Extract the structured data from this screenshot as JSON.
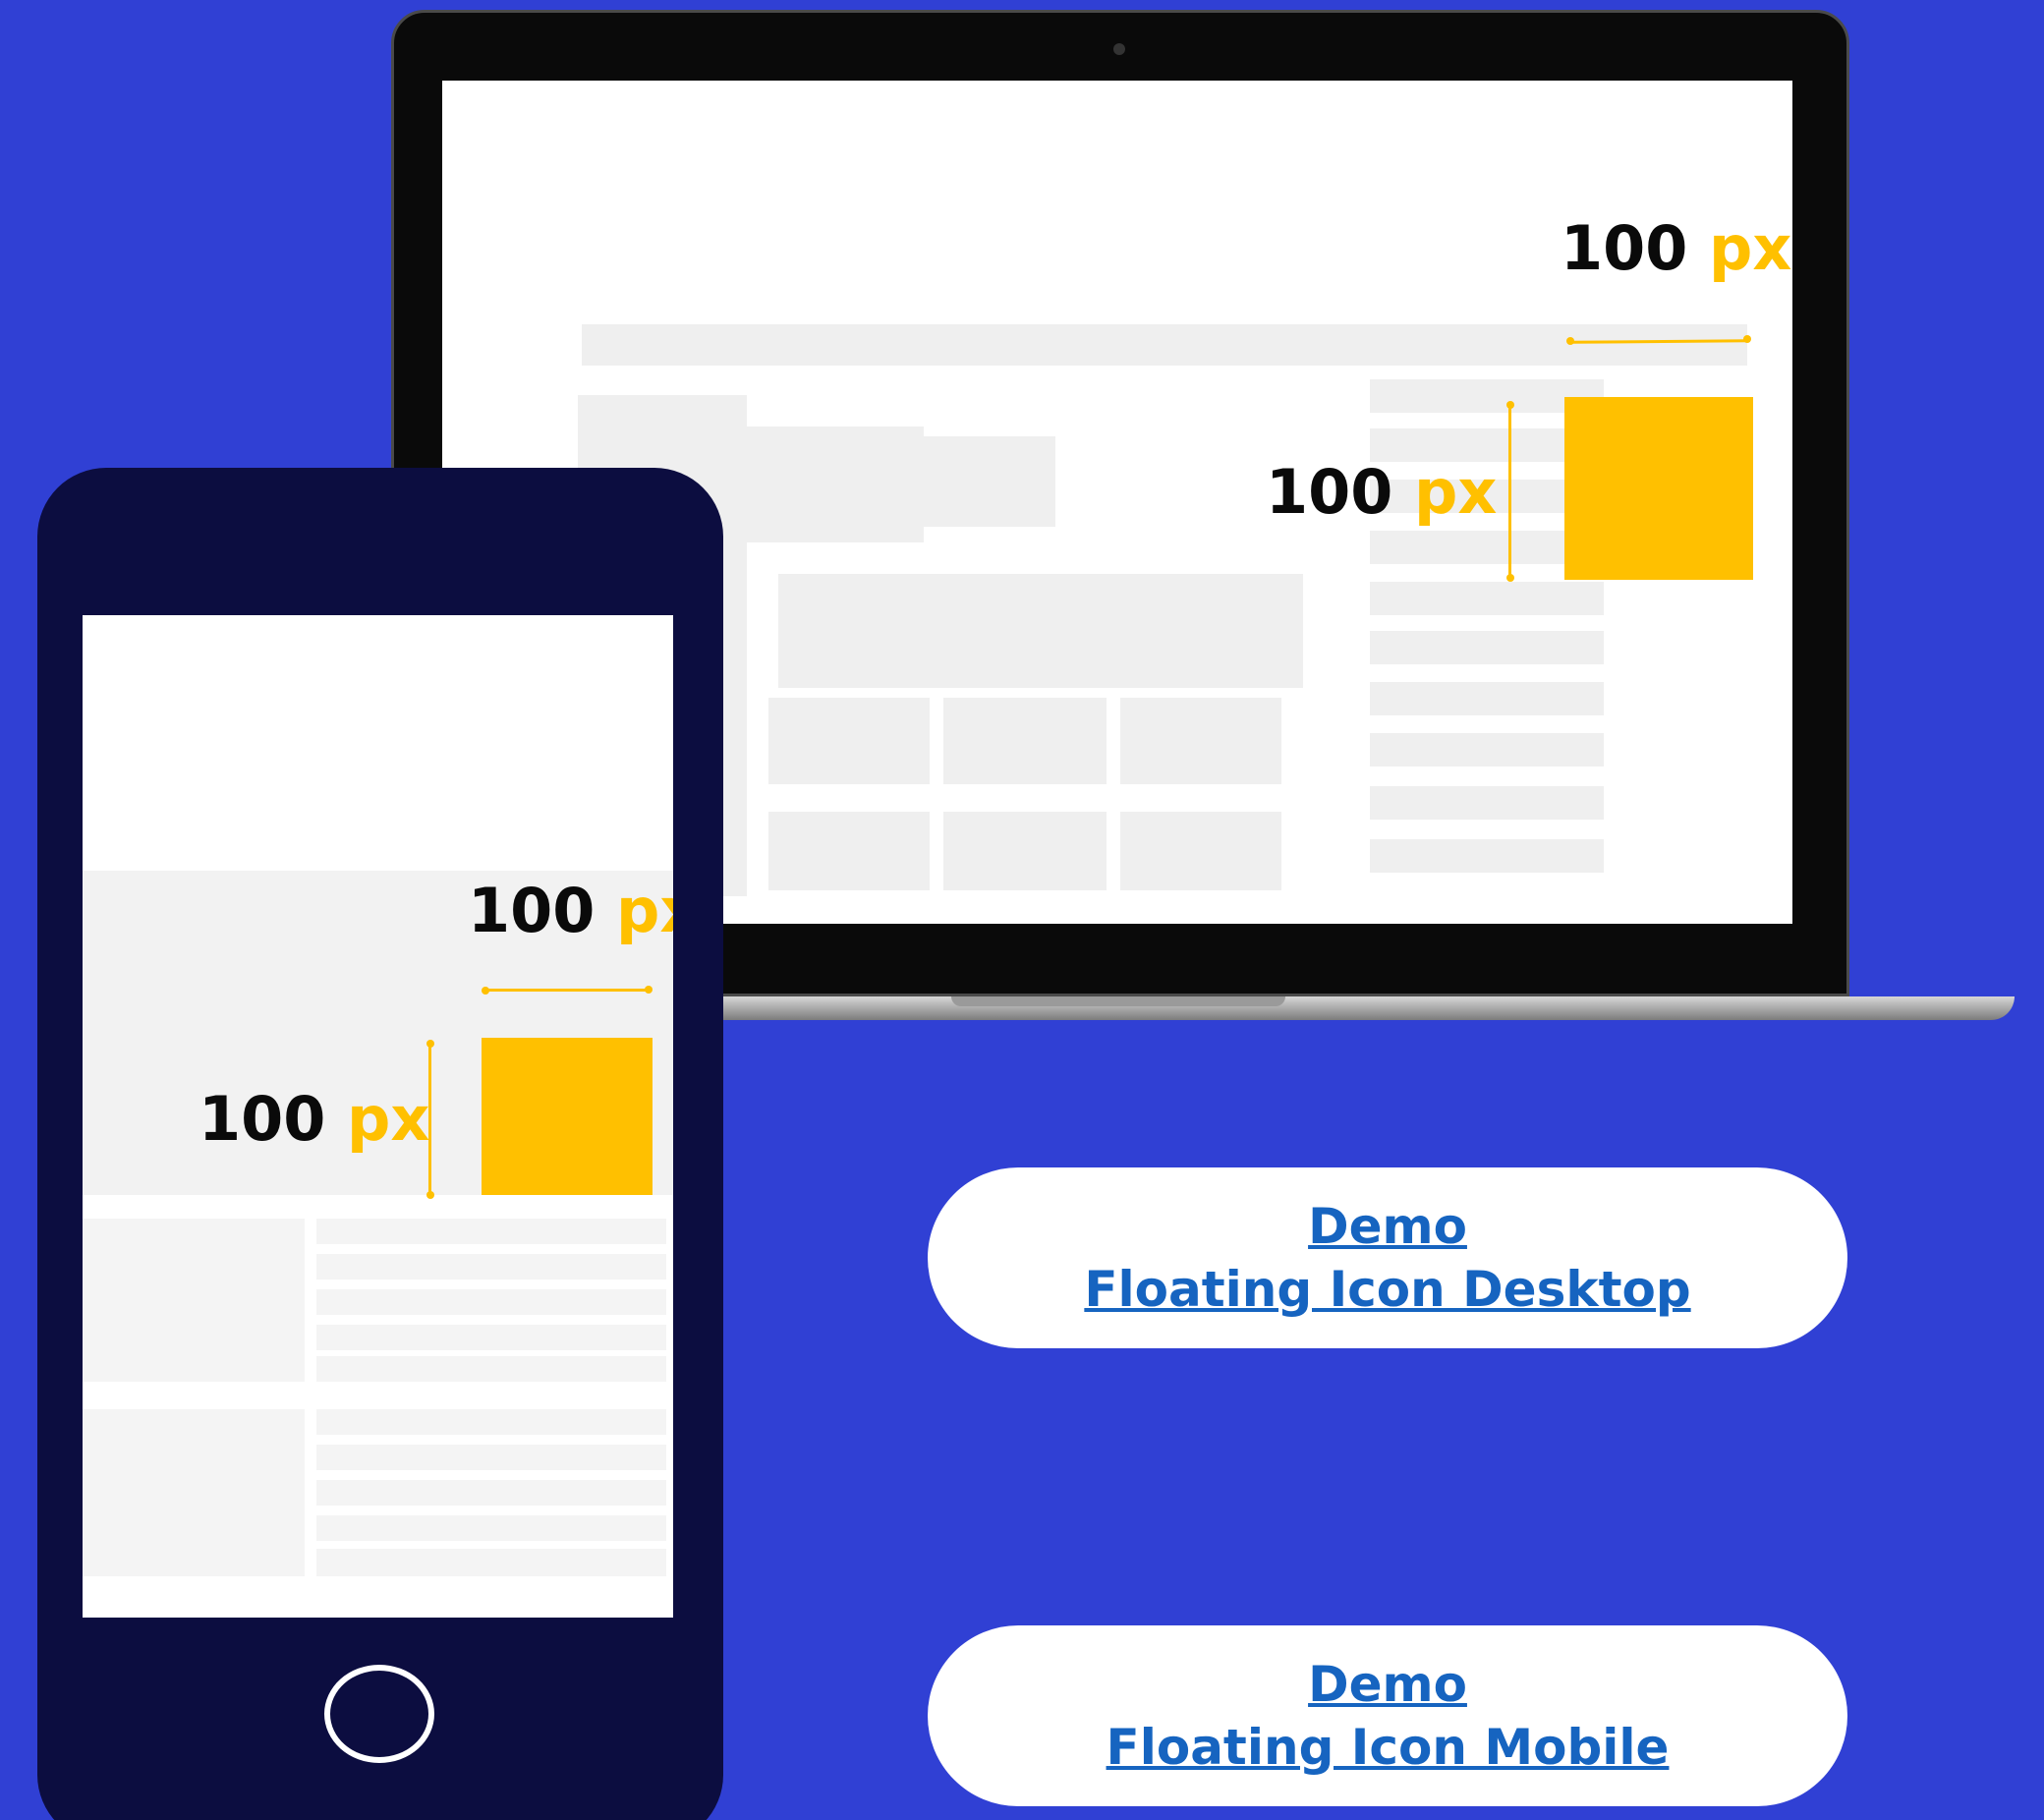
{
  "laptop": {
    "width_label": {
      "value": "100",
      "unit": "px"
    },
    "height_label": {
      "value": "100",
      "unit": "px"
    }
  },
  "phone": {
    "width_label": {
      "value": "100",
      "unit": "px"
    },
    "height_label": {
      "value": "100",
      "unit": "px"
    }
  },
  "buttons": {
    "desktop": {
      "line1": "Demo",
      "line2": "Floating Icon Desktop"
    },
    "mobile": {
      "line1": "Demo",
      "line2": "Floating Icon Mobile"
    }
  },
  "colors": {
    "background": "#3040d4",
    "accent": "#ffc000",
    "link": "#1664c0",
    "phone_body": "#0c0d40"
  }
}
